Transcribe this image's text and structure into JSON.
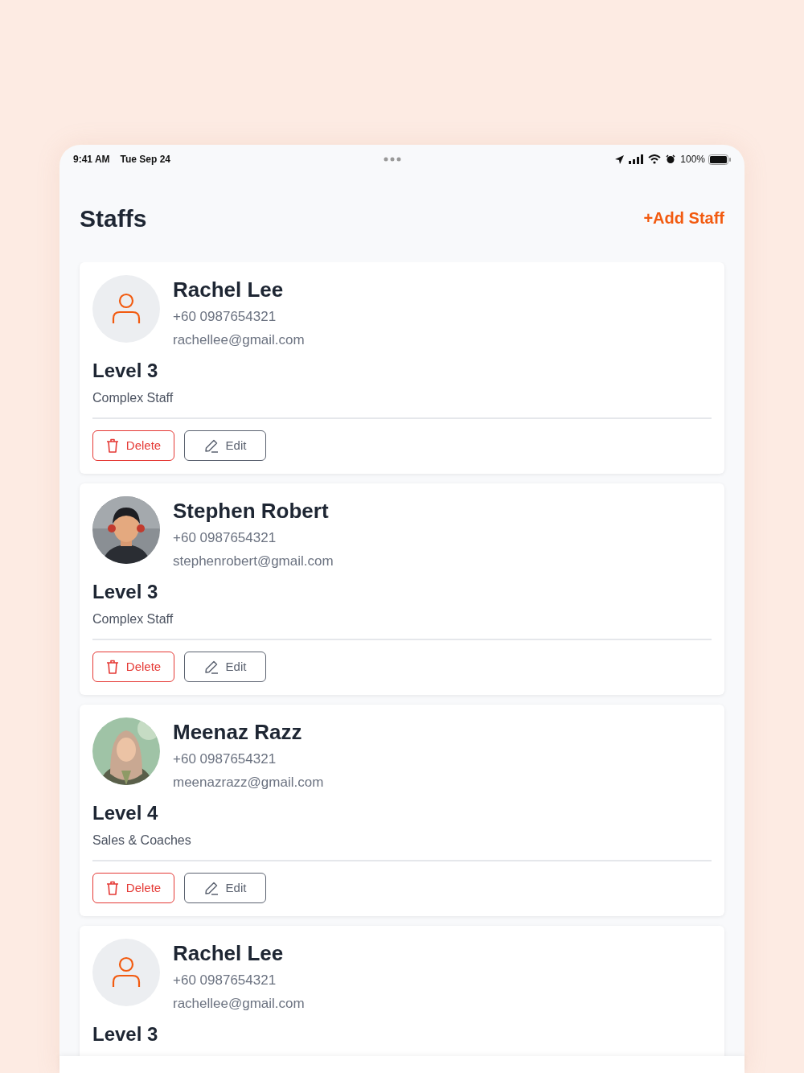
{
  "status_bar": {
    "time": "9:41 AM",
    "date": "Tue Sep 24",
    "battery": "100%"
  },
  "header": {
    "title": "Staffs",
    "action": "+Add Staff"
  },
  "staff": [
    {
      "avatar": {
        "kind": "icon"
      },
      "name": "Rachel Lee",
      "phone": "+60 0987654321",
      "email": "rachellee@gmail.com",
      "level": "Level 3",
      "role": "Complex Staff",
      "buttons": [
        "Delete",
        "Edit"
      ]
    },
    {
      "name": "Stephen Robert",
      "phone": "+60 0987654321",
      "email": "stephenrobert@gmail.com",
      "level": "Level 3",
      "role": "Complex Staff",
      "buttons": [
        "Delete",
        "Edit"
      ]
    },
    {
      "name": "Meenaz Razz",
      "phone": "+60 0987654321",
      "email": "meenazrazz@gmail.com",
      "level": "Level 4",
      "role": "Sales & Coaches",
      "buttons": [
        "Delete",
        "Edit"
      ]
    },
    {
      "avatar": {
        "kind": "icon"
      },
      "name": "Rachel Lee",
      "phone": "+60 0987654321",
      "email": "rachellee@gmail.com",
      "level": "Level 3"
    }
  ]
}
